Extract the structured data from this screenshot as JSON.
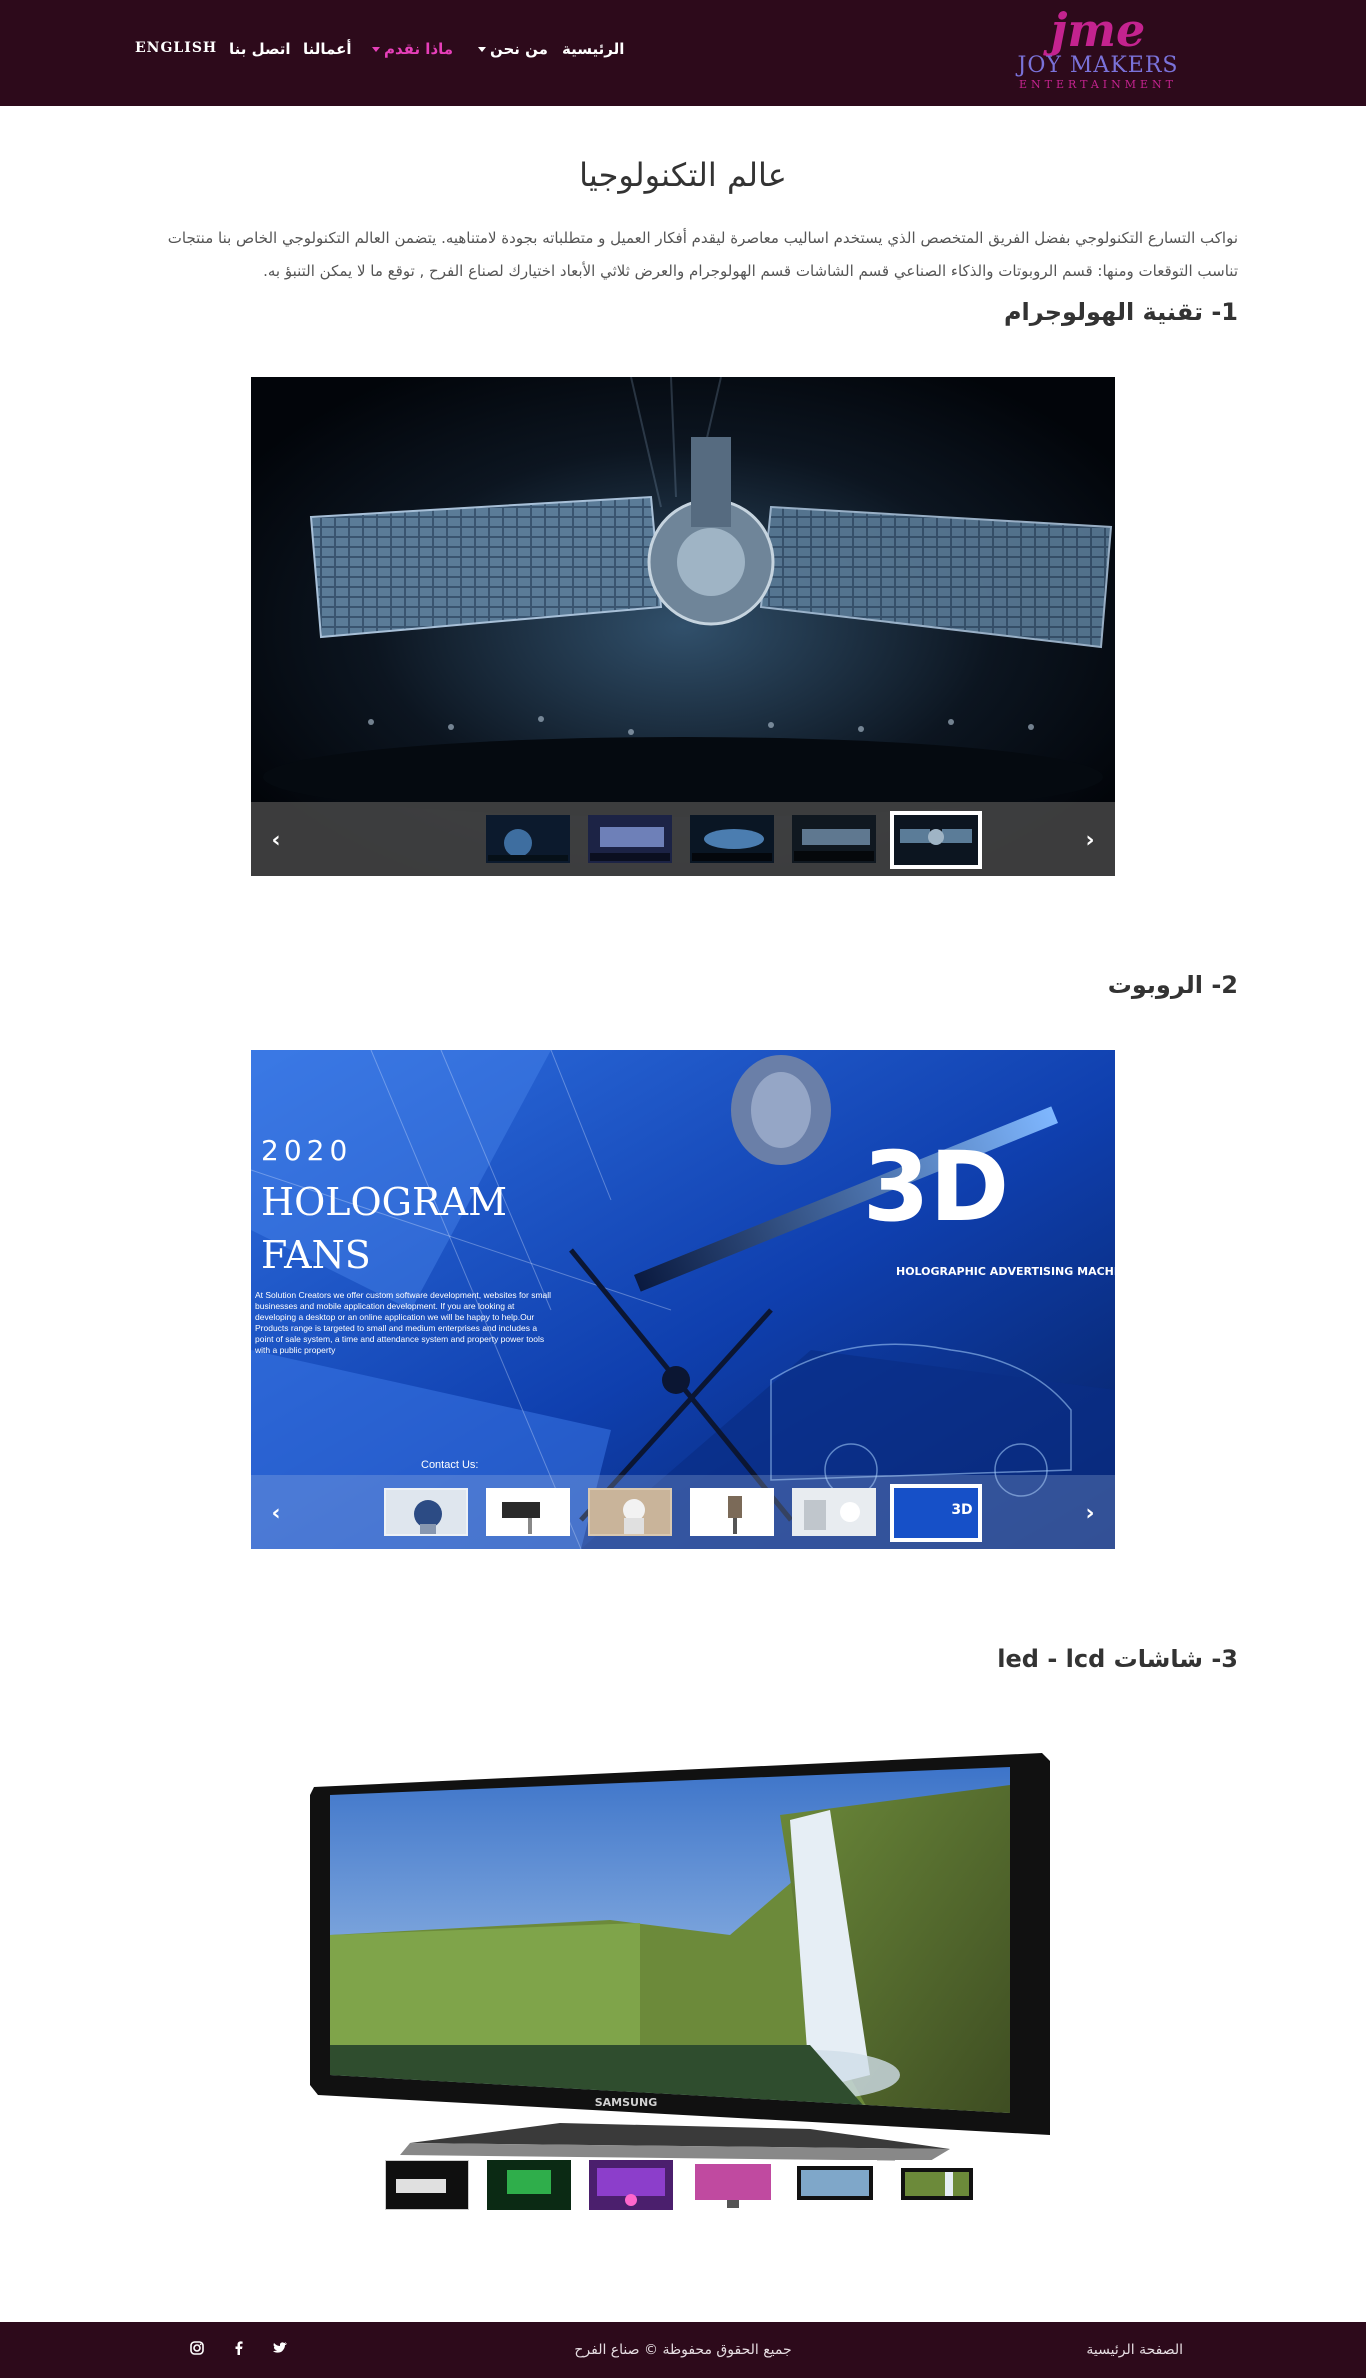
{
  "header": {
    "logo_text": "jme",
    "logo_line1": "JOY MAKERS",
    "logo_line2": "ENTERTAINMENT",
    "nav": {
      "home": "الرئيسية",
      "about": "من نحن",
      "services": "ماذا نقدم",
      "works": "أعمالنا",
      "contact": "اتصل بنا",
      "english": "ENGLISH"
    }
  },
  "main": {
    "title": "عالم التكنولوجيا",
    "intro": "نواكب التسارع التكنولوجي بفضل الفريق المتخصص الذي يستخدم اساليب معاصرة ليقدم أفكار العميل و متطلباته بجودة لامتناهيه. يتضمن العالم التكنولوجي الخاص بنا منتجات تناسب التوقعات ومنها: قسم الروبوتات والذكاء الصناعي قسم الشاشات قسم الهولوجرام والعرض ثلاثي الأبعاد اختيارك لصناع الفرح , توقع ما لا يمكن التنبؤ به.",
    "sections": [
      {
        "heading": "1- تقنية الهولوجرام"
      },
      {
        "heading": "2- الروبوت"
      },
      {
        "heading": "3- شاشات led - lcd"
      }
    ],
    "hologram_ad": {
      "year": "2020",
      "title_line1": "HOLOGRAM",
      "title_line2": "FANS",
      "body": "At Solution Creators we offer custom software development, websites for small businesses and mobile application development. If you are looking at developing a desktop or an online application we will be happy to help.Our Products range is targeted to small and medium enterprises and includes a point of sale system, a time and attendance system and property power tools with a public property",
      "contact": "Contact Us:",
      "big_3d": "3D",
      "machine": "HOLOGRAPHIC ADVERTISING MACHIN"
    },
    "tv_brand": "SAMSUNG"
  },
  "footer": {
    "home_link": "الصفحة الرئيسية",
    "copyright": "جميع الحقوق محفوظة © صناع الفرح",
    "twitter_icon": "twitter-icon",
    "facebook_icon": "facebook-icon",
    "instagram_icon": "instagram-icon"
  },
  "colors": {
    "header_bg": "#2d0a1b",
    "active_nav": "#e63fb9",
    "logo_magenta": "#c4238f",
    "logo_blue": "#6f6fd8"
  }
}
